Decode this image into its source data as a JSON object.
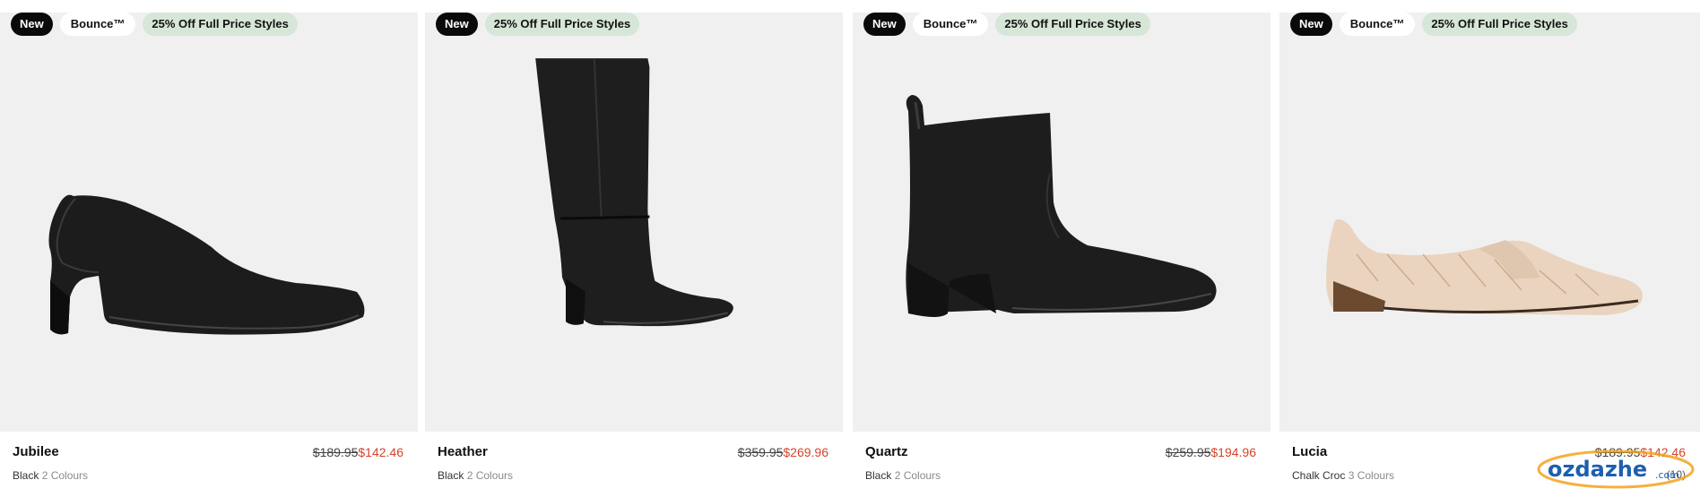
{
  "products": [
    {
      "badges": {
        "new": "New",
        "tech": "Bounce™",
        "promo": "25% Off Full Price Styles"
      },
      "name": "Jubilee",
      "was_price": "$189.95",
      "now_price": "$142.46",
      "colour": "Black",
      "colour_count": "2 Colours",
      "shoe": "pump"
    },
    {
      "badges": {
        "new": "New",
        "promo": "25% Off Full Price Styles"
      },
      "name": "Heather",
      "was_price": "$359.95",
      "now_price": "$269.96",
      "colour": "Black",
      "colour_count": "2 Colours",
      "shoe": "knee-boot"
    },
    {
      "badges": {
        "new": "New",
        "tech": "Bounce™",
        "promo": "25% Off Full Price Styles"
      },
      "name": "Quartz",
      "was_price": "$259.95",
      "now_price": "$194.96",
      "colour": "Black",
      "colour_count": "2 Colours",
      "shoe": "ankle-boot"
    },
    {
      "badges": {
        "new": "New",
        "tech": "Bounce™",
        "promo": "25% Off Full Price Styles"
      },
      "name": "Lucia",
      "was_price": "$189.95",
      "now_price": "$142.46",
      "colour": "Chalk Croc",
      "colour_count": "3 Colours",
      "reviews": "(10)",
      "shoe": "loafer"
    }
  ],
  "watermark": {
    "text": "ozdazhe",
    "suffix": ".com"
  },
  "colors": {
    "sale": "#d2452a",
    "tile_bg": "#f0f0f0",
    "promo_badge": "#d6e6d8"
  }
}
